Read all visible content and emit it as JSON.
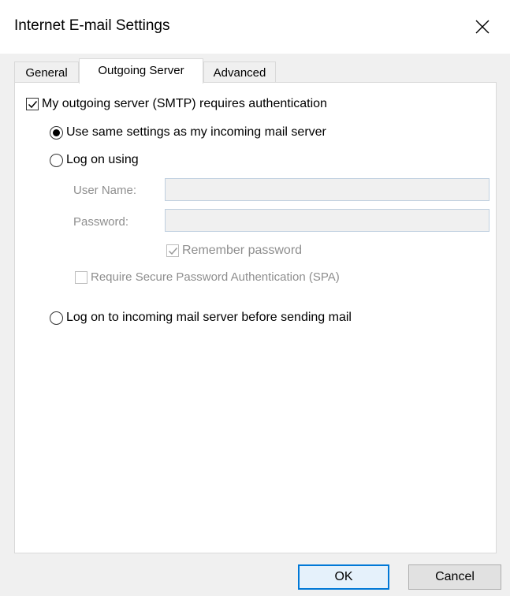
{
  "window": {
    "title": "Internet E-mail Settings",
    "close_icon": "close-icon"
  },
  "tabs": [
    {
      "label": "General",
      "active": false
    },
    {
      "label": "Outgoing Server",
      "active": true
    },
    {
      "label": "Advanced",
      "active": false
    }
  ],
  "outgoing": {
    "requires_auth": {
      "label": "My outgoing server (SMTP) requires authentication",
      "checked": true
    },
    "use_same": {
      "label": "Use same settings as my incoming mail server",
      "selected": true
    },
    "log_on_using": {
      "label": "Log on using",
      "selected": false
    },
    "user_name": {
      "label": "User Name:",
      "value": ""
    },
    "password": {
      "label": "Password:",
      "value": ""
    },
    "remember_password": {
      "label": "Remember password",
      "checked": true,
      "enabled": false
    },
    "spa": {
      "label": "Require Secure Password Authentication (SPA)",
      "checked": false,
      "enabled": false
    },
    "log_on_incoming": {
      "label": "Log on to incoming mail server before sending mail",
      "selected": false
    }
  },
  "buttons": {
    "ok": "OK",
    "cancel": "Cancel"
  }
}
